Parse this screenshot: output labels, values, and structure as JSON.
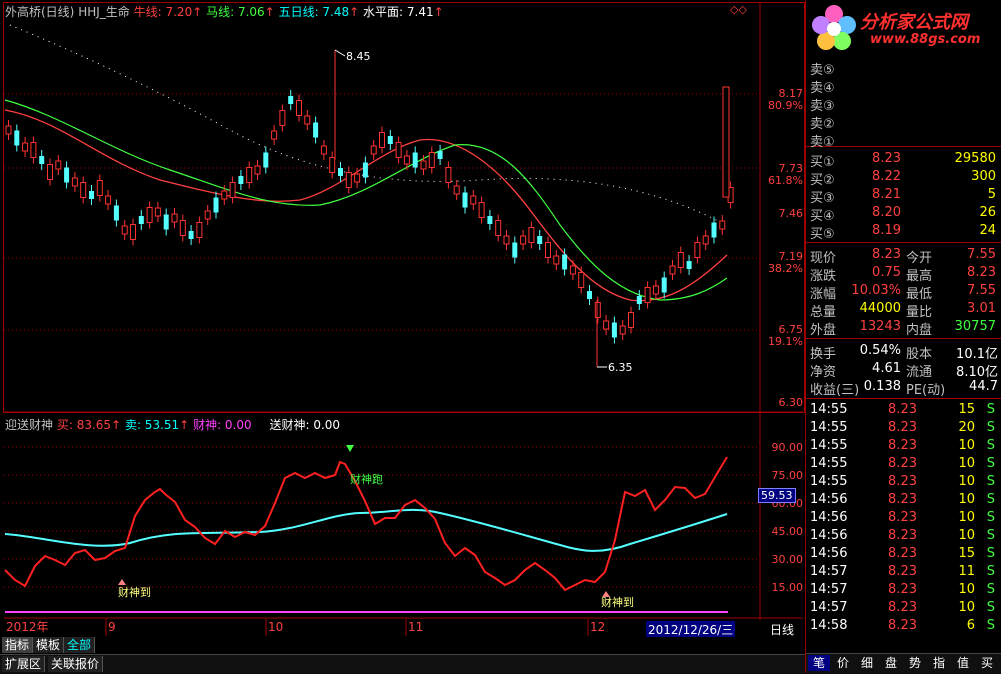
{
  "main_header": {
    "stock": "外高桥(日线)",
    "indicator": "HHJ_生命",
    "ma1": {
      "label": "牛线: 7.20",
      "color": "#ff4040"
    },
    "ma2": {
      "label": "马线: 7.06",
      "color": "#40ff40"
    },
    "ma3": {
      "label": "五日线: 7.48",
      "color": "#00ffff"
    },
    "ma4": {
      "label": "水平面: 7.41",
      "color": "#ffffff"
    }
  },
  "price_axis": [
    "8.17",
    "80.9%",
    "7.73",
    "61.8%",
    "7.46",
    "7.19",
    "38.2%",
    "6.75",
    "19.1%",
    "6.30"
  ],
  "price_annotations": {
    "high": "8.45",
    "low": "6.35"
  },
  "sub_header": {
    "name": "迎送财神",
    "buy": "买: 83.65",
    "sell": "卖: 53.51",
    "god": "财神: 0.00",
    "send": "送财神: 0.00"
  },
  "sub_axis": [
    "90.00",
    "75.00",
    "60.00",
    "45.00",
    "30.00",
    "15.00"
  ],
  "sub_current": "59.53",
  "sub_labels": {
    "arrive1": "财神到",
    "run": "财神跑",
    "arrive2": "财神到"
  },
  "x_axis": {
    "year": "2012年",
    "months": [
      "9",
      "10",
      "11",
      "12"
    ],
    "cursor_date": "2012/12/26/三",
    "period": "日线"
  },
  "bottom_tabs": [
    "指标",
    "模板",
    "全部"
  ],
  "bottom_tabs2": [
    "扩展区",
    "关联报价"
  ],
  "logo": {
    "title": "分析家公式网",
    "url": "www.88gs.com"
  },
  "sell_orders": [
    {
      "label": "卖⑤"
    },
    {
      "label": "卖④"
    },
    {
      "label": "卖③"
    },
    {
      "label": "卖②"
    },
    {
      "label": "卖①"
    }
  ],
  "buy_orders": [
    {
      "label": "买①",
      "price": "8.23",
      "vol": "29580"
    },
    {
      "label": "买②",
      "price": "8.22",
      "vol": "300"
    },
    {
      "label": "买③",
      "price": "8.21",
      "vol": "5"
    },
    {
      "label": "买④",
      "price": "8.20",
      "vol": "26"
    },
    {
      "label": "买⑤",
      "price": "8.19",
      "vol": "24"
    }
  ],
  "quote": [
    {
      "l1": "现价",
      "v1": "8.23",
      "c1": "#ff4040",
      "l2": "今开",
      "v2": "7.55",
      "c2": "#ff4040"
    },
    {
      "l1": "涨跌",
      "v1": "0.75",
      "c1": "#ff4040",
      "l2": "最高",
      "v2": "8.23",
      "c2": "#ff4040"
    },
    {
      "l1": "涨幅",
      "v1": "10.03%",
      "c1": "#ff4040",
      "l2": "最低",
      "v2": "7.55",
      "c2": "#ff4040"
    },
    {
      "l1": "总量",
      "v1": "44000",
      "c1": "#ffff00",
      "l2": "量比",
      "v2": "3.01",
      "c2": "#ff4040"
    },
    {
      "l1": "外盘",
      "v1": "13243",
      "c1": "#ff4040",
      "l2": "内盘",
      "v2": "30757",
      "c2": "#40ff40"
    }
  ],
  "fundamentals": [
    {
      "l1": "换手",
      "v1": "0.54%",
      "l2": "股本",
      "v2": "10.1亿"
    },
    {
      "l1": "净资",
      "v1": "4.61",
      "l2": "流通",
      "v2": "8.10亿"
    },
    {
      "l1": "收益(三)",
      "v1": "0.138",
      "l2": "PE(动)",
      "v2": "44.7"
    }
  ],
  "ticks": [
    {
      "time": "14:55",
      "price": "8.23",
      "vol": "15",
      "flag": "S"
    },
    {
      "time": "14:55",
      "price": "8.23",
      "vol": "20",
      "flag": "S"
    },
    {
      "time": "14:55",
      "price": "8.23",
      "vol": "10",
      "flag": "S"
    },
    {
      "time": "14:55",
      "price": "8.23",
      "vol": "10",
      "flag": "S"
    },
    {
      "time": "14:55",
      "price": "8.23",
      "vol": "10",
      "flag": "S"
    },
    {
      "time": "14:56",
      "price": "8.23",
      "vol": "10",
      "flag": "S"
    },
    {
      "time": "14:56",
      "price": "8.23",
      "vol": "10",
      "flag": "S"
    },
    {
      "time": "14:56",
      "price": "8.23",
      "vol": "10",
      "flag": "S"
    },
    {
      "time": "14:56",
      "price": "8.23",
      "vol": "15",
      "flag": "S"
    },
    {
      "time": "14:57",
      "price": "8.23",
      "vol": "11",
      "flag": "S"
    },
    {
      "time": "14:57",
      "price": "8.23",
      "vol": "10",
      "flag": "S"
    },
    {
      "time": "14:57",
      "price": "8.23",
      "vol": "10",
      "flag": "S"
    },
    {
      "time": "14:58",
      "price": "8.23",
      "vol": "6",
      "flag": "S"
    }
  ],
  "right_tabs": [
    "笔",
    "价",
    "细",
    "盘",
    "势",
    "指",
    "值",
    "买"
  ],
  "colors": {
    "up": "#ff3232",
    "down": "#54ffff",
    "grid": "#a00000",
    "bg": "#000000"
  }
}
